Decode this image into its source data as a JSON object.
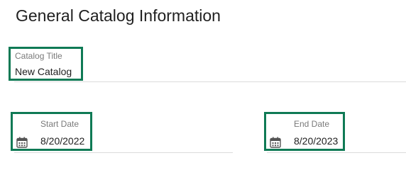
{
  "section": {
    "title": "General Catalog Information"
  },
  "catalog_title": {
    "label": "Catalog Title",
    "value": "New Catalog"
  },
  "start_date": {
    "label": "Start Date",
    "value": "8/20/2022",
    "icon": "calendar-icon"
  },
  "end_date": {
    "label": "End Date",
    "value": "8/20/2023",
    "icon": "calendar-icon"
  },
  "colors": {
    "highlight": "#0f7a55",
    "underline": "#dcdcdc",
    "label": "#7a7a7a",
    "text": "#212121"
  }
}
